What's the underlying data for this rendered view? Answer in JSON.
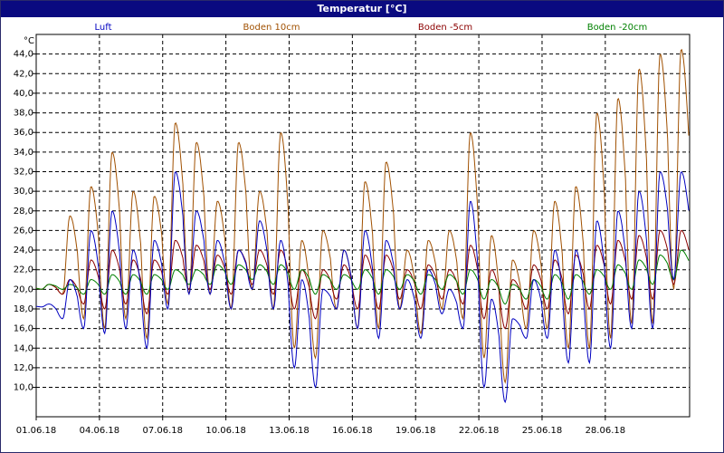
{
  "window": {
    "title": "Temperatur [°C]"
  },
  "chart_data": {
    "type": "line",
    "title": "Temperatur [°C]",
    "ylabel": "°C",
    "xlabel": "",
    "ylim": [
      7.0,
      46.0
    ],
    "xlim": [
      0,
      31
    ],
    "yticks": [
      10.0,
      12.0,
      14.0,
      16.0,
      18.0,
      20.0,
      22.0,
      24.0,
      26.0,
      28.0,
      30.0,
      32.0,
      34.0,
      36.0,
      38.0,
      40.0,
      42.0,
      44.0
    ],
    "ytick_labels": [
      "10,0",
      "12,0",
      "14,0",
      "16,0",
      "18,0",
      "20,0",
      "22,0",
      "24,0",
      "26,0",
      "28,0",
      "30,0",
      "32,0",
      "34,0",
      "36,0",
      "38,0",
      "40,0",
      "42,0",
      "44,0"
    ],
    "xticks": [
      0,
      3,
      6,
      9,
      12,
      15,
      18,
      21,
      24,
      27
    ],
    "xtick_labels": [
      "01.06.18",
      "04.06.18",
      "07.06.18",
      "10.06.18",
      "13.06.18",
      "16.06.18",
      "19.06.18",
      "22.06.18",
      "25.06.18",
      "28.06.18"
    ],
    "grid": true,
    "legend_position": "top",
    "series": [
      {
        "name": "Luft",
        "color": "#0000c0",
        "day": [
          0,
          1,
          2,
          3,
          4,
          5,
          6,
          7,
          8,
          9,
          10,
          11,
          12,
          13,
          14,
          15,
          16,
          17,
          18,
          19,
          20,
          21,
          22,
          23,
          24,
          25,
          26,
          27,
          28,
          29,
          30
        ],
        "min": [
          18.2,
          17.0,
          16.0,
          15.5,
          16.0,
          14.0,
          18.0,
          19.5,
          19.5,
          18.0,
          20.0,
          18.0,
          12.0,
          10.0,
          18.0,
          16.0,
          15.0,
          18.0,
          15.0,
          17.5,
          16.0,
          10.0,
          8.5,
          15.0,
          15.0,
          12.5,
          12.5,
          14.0,
          16.0,
          16.0,
          21.0
        ],
        "max": [
          18.5,
          21.0,
          26.0,
          28.0,
          24.0,
          25.0,
          32.0,
          28.0,
          25.0,
          24.0,
          27.0,
          25.0,
          21.0,
          20.0,
          24.0,
          26.0,
          25.0,
          21.0,
          22.0,
          20.0,
          29.0,
          19.0,
          17.0,
          21.0,
          24.0,
          24.0,
          27.0,
          28.0,
          30.0,
          32.0,
          32.0
        ]
      },
      {
        "name": "Boden 10cm",
        "color": "#a05000",
        "day": [
          0,
          1,
          2,
          3,
          4,
          5,
          6,
          7,
          8,
          9,
          10,
          11,
          12,
          13,
          14,
          15,
          16,
          17,
          18,
          19,
          20,
          21,
          22,
          23,
          24,
          25,
          26,
          27,
          28,
          29,
          30
        ],
        "min": [
          20.0,
          19.5,
          17.0,
          16.0,
          17.0,
          15.0,
          18.5,
          19.5,
          19.5,
          18.0,
          20.0,
          18.0,
          14.0,
          13.0,
          18.0,
          16.0,
          16.0,
          18.0,
          15.5,
          18.0,
          17.0,
          13.0,
          10.5,
          16.0,
          16.0,
          14.0,
          14.0,
          15.0,
          16.5,
          16.5,
          20.0
        ],
        "max": [
          20.5,
          27.5,
          30.5,
          34.0,
          30.0,
          29.5,
          37.0,
          35.0,
          29.0,
          35.0,
          30.0,
          36.0,
          25.0,
          26.0,
          24.0,
          31.0,
          33.0,
          24.0,
          25.0,
          26.0,
          36.0,
          25.5,
          23.0,
          26.0,
          29.0,
          30.5,
          38.0,
          39.5,
          42.5,
          44.0,
          44.5
        ]
      },
      {
        "name": "Boden -5cm",
        "color": "#8b0000",
        "day": [
          0,
          1,
          2,
          3,
          4,
          5,
          6,
          7,
          8,
          9,
          10,
          11,
          12,
          13,
          14,
          15,
          16,
          17,
          18,
          19,
          20,
          21,
          22,
          23,
          24,
          25,
          26,
          27,
          28,
          29,
          30
        ],
        "min": [
          20.0,
          19.5,
          18.5,
          18.0,
          18.5,
          17.5,
          19.5,
          20.0,
          20.0,
          19.5,
          20.5,
          19.5,
          18.0,
          17.0,
          19.0,
          18.0,
          18.0,
          19.0,
          18.0,
          19.0,
          18.5,
          17.0,
          16.0,
          18.0,
          18.0,
          17.5,
          18.0,
          18.5,
          19.0,
          19.0,
          20.5
        ],
        "max": [
          20.5,
          21.0,
          23.0,
          24.0,
          23.0,
          23.0,
          25.0,
          24.5,
          23.5,
          24.0,
          24.0,
          24.0,
          22.0,
          22.0,
          22.5,
          23.5,
          23.5,
          22.0,
          22.5,
          22.0,
          24.5,
          22.0,
          21.0,
          22.5,
          23.0,
          23.5,
          24.5,
          25.0,
          25.5,
          26.0,
          26.0
        ]
      },
      {
        "name": "Boden -20cm",
        "color": "#008000",
        "day": [
          0,
          1,
          2,
          3,
          4,
          5,
          6,
          7,
          8,
          9,
          10,
          11,
          12,
          13,
          14,
          15,
          16,
          17,
          18,
          19,
          20,
          21,
          22,
          23,
          24,
          25,
          26,
          27,
          28,
          29,
          30
        ],
        "min": [
          20.0,
          20.0,
          19.5,
          19.5,
          19.5,
          19.5,
          20.0,
          20.5,
          20.5,
          20.5,
          21.0,
          20.5,
          20.0,
          19.5,
          20.0,
          20.0,
          19.5,
          20.0,
          19.5,
          20.0,
          19.5,
          19.0,
          18.5,
          19.0,
          19.0,
          19.0,
          19.5,
          20.0,
          20.0,
          20.5,
          21.0
        ],
        "max": [
          20.5,
          20.5,
          21.0,
          21.5,
          21.5,
          21.5,
          22.0,
          22.0,
          22.5,
          22.5,
          22.5,
          22.5,
          22.0,
          21.5,
          21.5,
          22.0,
          22.0,
          21.5,
          21.5,
          21.5,
          22.0,
          21.0,
          20.5,
          21.0,
          21.5,
          21.5,
          22.0,
          22.5,
          23.0,
          23.5,
          24.0
        ]
      }
    ]
  }
}
